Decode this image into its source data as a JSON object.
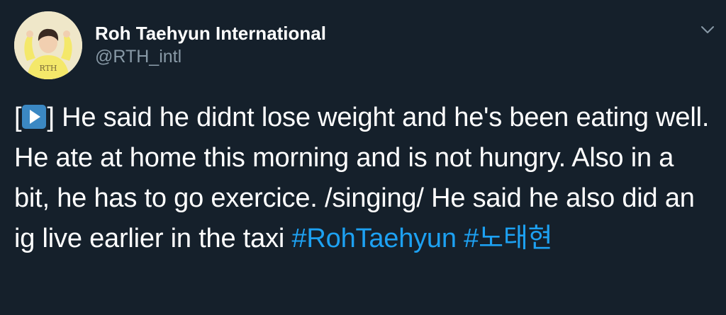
{
  "tweet": {
    "display_name": "Roh Taehyun International",
    "handle": "@RTH_intl",
    "avatar_text": "RTH",
    "text_open_bracket": "[",
    "play_emoji": "play-button-emoji",
    "text_after_emoji": "] He said he didnt lose weight and he's been eating well. He ate at home this morning and is not hungry. Also in a bit, he has to go exercice. /singing/ He said he also did an ig live earlier in the taxi",
    "hashtags": [
      "#RohTaehyun",
      "#노태현"
    ],
    "more_icon": "chevron-down-icon"
  },
  "colors": {
    "background": "#15202b",
    "text": "#ffffff",
    "secondary_text": "#8899a6",
    "link": "#1da1f2",
    "emoji_blue": "#3b88c3"
  }
}
